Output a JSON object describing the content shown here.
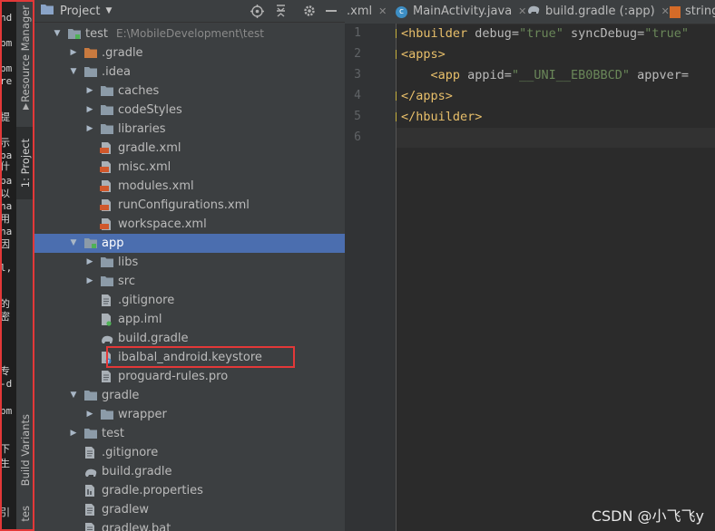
{
  "left_strip_fragments": [
    "nd",
    "pm",
    "pm",
    "re",
    "提",
    "示",
    "ba",
    "什",
    "ba",
    "以",
    "ha",
    "用",
    "ha",
    "因",
    "l,",
    "的",
    "密",
    "专",
    "-d",
    "pm",
    "下",
    "生",
    "引"
  ],
  "tool_window_tabs": {
    "resource_manager": "Resource Manager",
    "project": "1: Project",
    "build_variants": "Build Variants",
    "structure": "tes"
  },
  "panel": {
    "title": "Project",
    "root_path": "E:\\MobileDevelopment\\test"
  },
  "tree": [
    {
      "label": "test",
      "icon": "folder-module-icon",
      "arrow": "expanded"
    },
    {
      "label": ".gradle",
      "icon": "folder-excluded-icon",
      "arrow": "collapsed"
    },
    {
      "label": ".idea",
      "icon": "folder-icon",
      "arrow": "expanded"
    },
    {
      "label": "caches",
      "icon": "folder-icon",
      "arrow": "collapsed"
    },
    {
      "label": "codeStyles",
      "icon": "folder-icon",
      "arrow": "collapsed"
    },
    {
      "label": "libraries",
      "icon": "folder-icon",
      "arrow": "collapsed"
    },
    {
      "label": "gradle.xml",
      "icon": "xml-file-icon",
      "arrow": "none"
    },
    {
      "label": "misc.xml",
      "icon": "xml-file-icon",
      "arrow": "none"
    },
    {
      "label": "modules.xml",
      "icon": "xml-file-icon",
      "arrow": "none"
    },
    {
      "label": "runConfigurations.xml",
      "icon": "xml-file-icon",
      "arrow": "none"
    },
    {
      "label": "workspace.xml",
      "icon": "xml-file-icon",
      "arrow": "none"
    },
    {
      "label": "app",
      "icon": "folder-module-icon",
      "arrow": "expanded"
    },
    {
      "label": "libs",
      "icon": "folder-icon",
      "arrow": "collapsed"
    },
    {
      "label": "src",
      "icon": "folder-icon",
      "arrow": "collapsed"
    },
    {
      "label": ".gitignore",
      "icon": "text-file-icon",
      "arrow": "none"
    },
    {
      "label": "app.iml",
      "icon": "iml-file-icon",
      "arrow": "none"
    },
    {
      "label": "build.gradle",
      "icon": "gradle-elephant-icon",
      "arrow": "none"
    },
    {
      "label": "ibalbal_android.keystore",
      "icon": "unknown-file-icon",
      "arrow": "none"
    },
    {
      "label": "proguard-rules.pro",
      "icon": "text-file-icon",
      "arrow": "none"
    },
    {
      "label": "gradle",
      "icon": "folder-icon",
      "arrow": "expanded"
    },
    {
      "label": "wrapper",
      "icon": "folder-icon",
      "arrow": "collapsed"
    },
    {
      "label": "test",
      "icon": "folder-icon",
      "arrow": "collapsed"
    },
    {
      "label": ".gitignore",
      "icon": "text-file-icon",
      "arrow": "none"
    },
    {
      "label": "build.gradle",
      "icon": "gradle-elephant-icon",
      "arrow": "none"
    },
    {
      "label": "gradle.properties",
      "icon": "properties-file-icon",
      "arrow": "none"
    },
    {
      "label": "gradlew",
      "icon": "text-file-icon",
      "arrow": "none"
    },
    {
      "label": "gradlew.bat",
      "icon": "text-file-icon",
      "arrow": "none"
    }
  ],
  "editor_tabs": [
    {
      "label": ".xml",
      "icon": "none"
    },
    {
      "label": "MainActivity.java",
      "icon": "java-class-icon"
    },
    {
      "label": "build.gradle (:app)",
      "icon": "gradle-elephant-icon"
    },
    {
      "label": "string",
      "icon": "xml-file-icon"
    }
  ],
  "line_numbers": [
    "1",
    "2",
    "3",
    "4",
    "5",
    "6"
  ],
  "code": {
    "l1_tag": "<hbuilder",
    "l1_attr1": " debug=",
    "l1_val1": "\"true\"",
    "l1_attr2": " syncDebug=",
    "l1_val2": "\"true\"",
    "l2": "<apps>",
    "l3_indent": "    ",
    "l3_tag": "<app",
    "l3_attr1": " appid=",
    "l3_val1": "\"__UNI__EB0BBCD\"",
    "l3_attr2": " appver=",
    "l4": "</apps>",
    "l5": "</hbuilder>"
  },
  "watermark": "CSDN @小飞飞y",
  "colors": {
    "selection": "#4b6eaf",
    "highlight_red": "#e33838",
    "xml_tag": "#e8bf6a",
    "xml_string": "#6a8759"
  }
}
